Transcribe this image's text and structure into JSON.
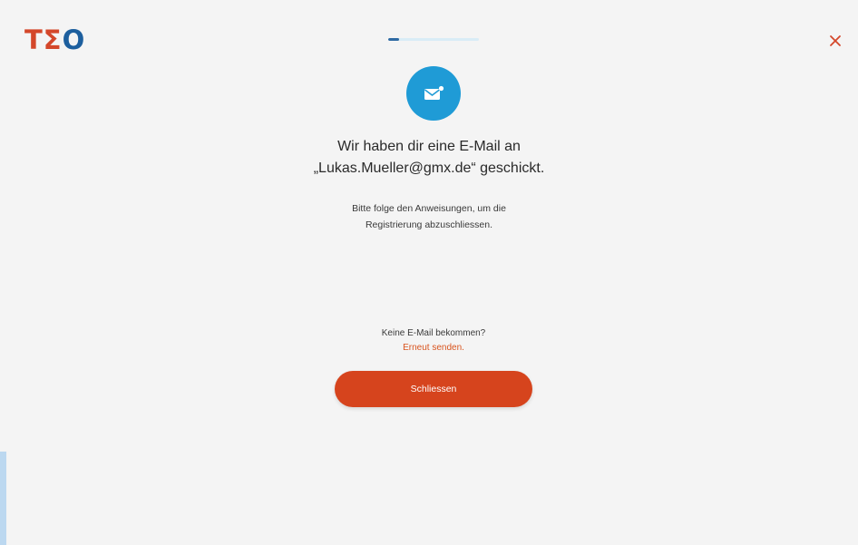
{
  "header": {
    "logo_letters": [
      "T",
      "Σ",
      "O"
    ],
    "logo_text": "TΣO",
    "progress_fraction": 0.12,
    "close_icon": "close-icon"
  },
  "confirmation": {
    "icon": "mail-icon",
    "headline_line1": "Wir haben dir eine E-Mail an",
    "headline_line2": "„Lukas.Mueller@gmx.de“ geschickt.",
    "instructions_line1": "Bitte folge den Anweisungen, um die",
    "instructions_line2": "Registrierung abzuschliessen."
  },
  "resend": {
    "question": "Keine E-Mail bekommen?",
    "link_label": "Erneut senden."
  },
  "actions": {
    "close_label": "Schliessen"
  },
  "colors": {
    "accent": "#d6441d",
    "icon_circle": "#1f9bd6",
    "logo_blue": "#1d5f9e",
    "background": "#f4f4f4"
  }
}
